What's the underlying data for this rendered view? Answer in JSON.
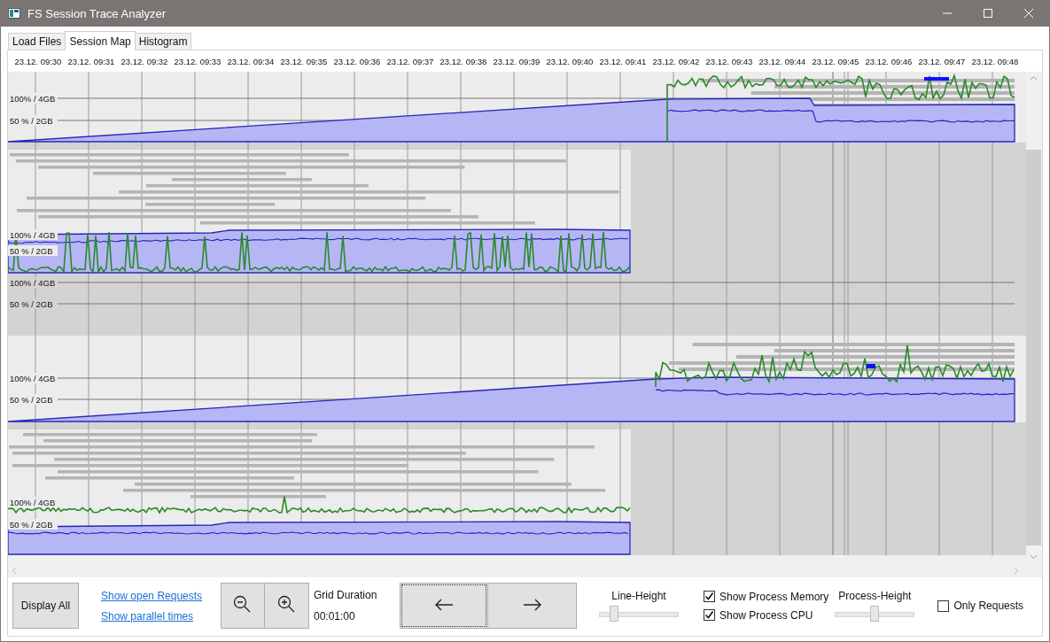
{
  "window": {
    "title": "FS Session Trace Analyzer"
  },
  "tabs": [
    {
      "label": "Load Files",
      "selected": false
    },
    {
      "label": "Session Map",
      "selected": true
    },
    {
      "label": "Histogram",
      "selected": false
    }
  ],
  "time_labels": [
    "23.12. 09:30",
    "23.12. 09:31",
    "23.12. 09:32",
    "23.12. 09:33",
    "23.12. 09:34",
    "23.12. 09:35",
    "23.12. 09:36",
    "23.12. 09:37",
    "23.12. 09:38",
    "23.12. 09:39",
    "23.12. 09:40",
    "23.12. 09:41",
    "23.12. 09:42",
    "23.12. 09:43",
    "23.12. 09:44",
    "23.12. 09:45",
    "23.12. 09:46",
    "23.12. 09:47",
    "23.12. 09:48"
  ],
  "lanes": [
    {
      "kind": "late",
      "labels": [
        "100% / 4GB",
        "50 % / 2GB"
      ]
    },
    {
      "kind": "early",
      "labels": [
        "100% / 4GB",
        "50 % / 2GB"
      ]
    },
    {
      "kind": "idle",
      "labels": [
        "100% / 4GB",
        "50 % / 2GB"
      ]
    },
    {
      "kind": "late",
      "labels": [
        "100% / 4GB",
        "50 % / 2GB"
      ]
    },
    {
      "kind": "early",
      "labels": [
        "100% / 4GB",
        "50 % / 2GB"
      ]
    }
  ],
  "toolbar": {
    "display_all": "Display All",
    "links": [
      "Show open Requests",
      "Show parallel times"
    ],
    "grid_duration": {
      "label": "Grid Duration",
      "value": "00:01:00"
    },
    "sliders": [
      {
        "label": "Line-Height",
        "level": 0.15
      },
      {
        "label": "Process-Height",
        "level": 0.5
      }
    ],
    "checkboxes": [
      {
        "label": "Show Process Memory",
        "checked": true
      },
      {
        "label": "Show Process CPU",
        "checked": true
      },
      {
        "label": "Only Requests",
        "checked": false
      }
    ]
  }
}
